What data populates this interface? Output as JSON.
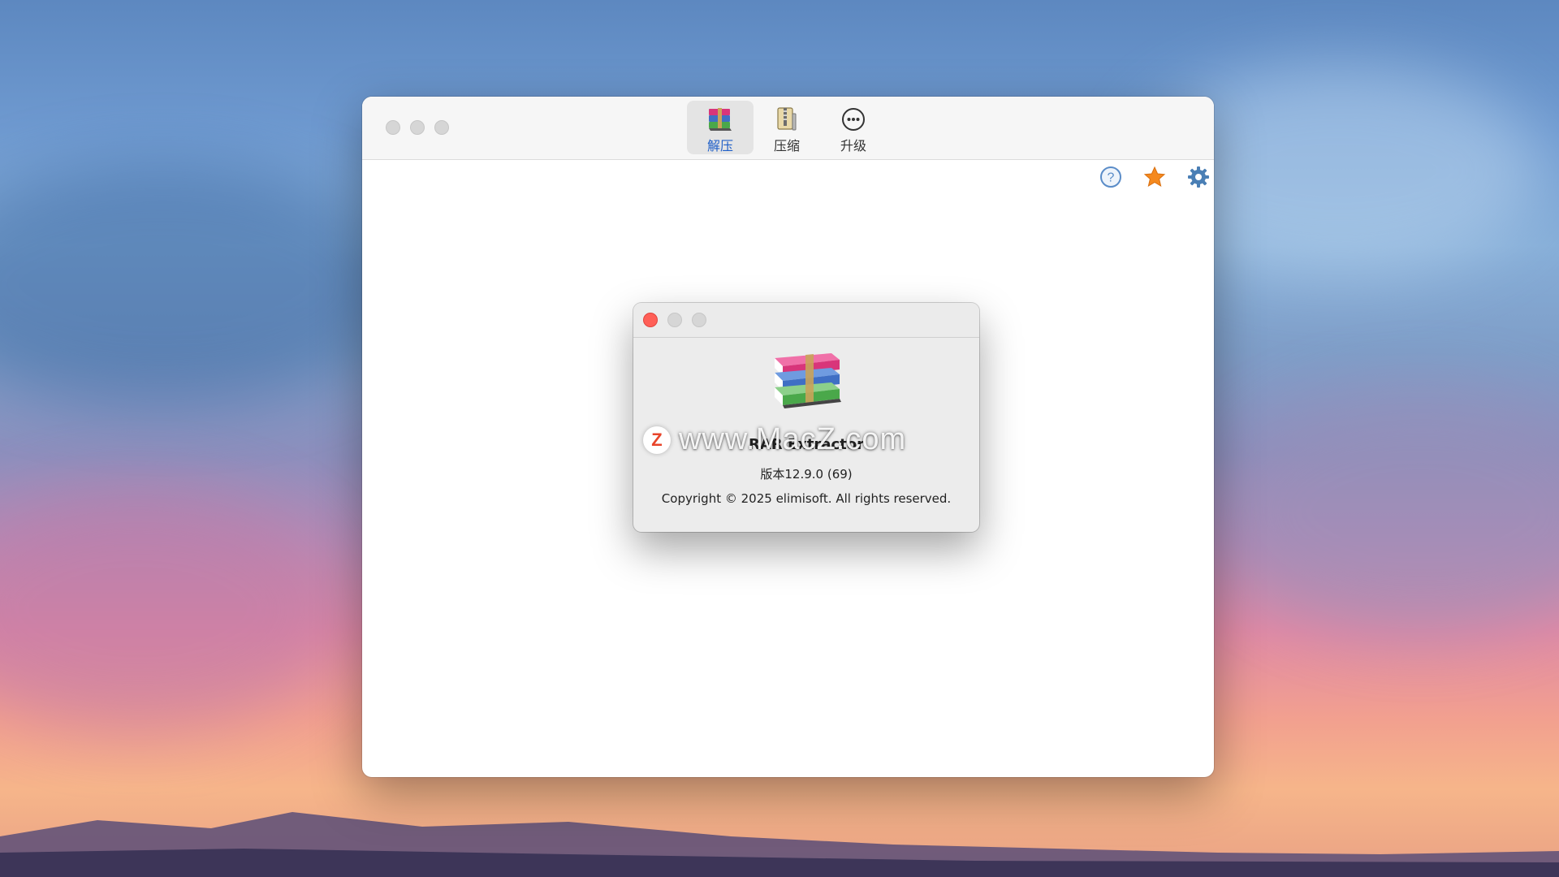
{
  "main_window": {
    "tabs": [
      {
        "label": "解压",
        "icon": "rar-books-icon",
        "active": true
      },
      {
        "label": "压缩",
        "icon": "zip-archive-icon",
        "active": false
      },
      {
        "label": "升级",
        "icon": "more-circle-icon",
        "active": false
      }
    ],
    "top_icons": [
      "help-icon",
      "star-icon",
      "gear-icon"
    ]
  },
  "about_dialog": {
    "app_name": "RAR Extractor",
    "version": "版本12.9.0 (69)",
    "copyright": "Copyright © 2025 elimisoft. All rights reserved."
  },
  "watermark": {
    "logo_letter": "Z",
    "text": "www.MacZ.com"
  },
  "colors": {
    "accent": "#1f5fc8",
    "close_red": "#ff5f57",
    "star_orange": "#f5891e",
    "gear_blue": "#4a7fb5"
  }
}
